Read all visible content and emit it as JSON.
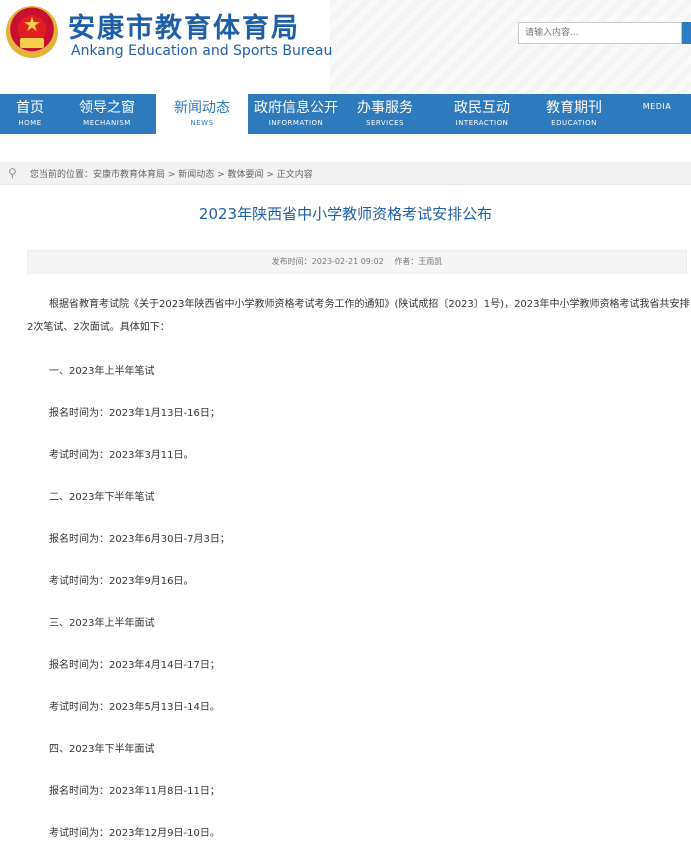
{
  "header": {
    "title": "安康市教育体育局",
    "subtitle": "Ankang Education and Sports Bureau",
    "search_placeholder": "请输入内容..."
  },
  "nav": {
    "items": [
      {
        "cn": "首页",
        "en": "HOME"
      },
      {
        "cn": "领导之窗",
        "en": "MECHANISM"
      },
      {
        "cn": "新闻动态",
        "en": "NEWS"
      },
      {
        "cn": "政府信息公开",
        "en": "INFORMATION"
      },
      {
        "cn": "办事服务",
        "en": "SERVICES"
      },
      {
        "cn": "政民互动",
        "en": "INTERACTION"
      },
      {
        "cn": "教育期刊",
        "en": "EDUCATION"
      },
      {
        "cn": "",
        "en": "MEDIA"
      }
    ]
  },
  "breadcrumb": {
    "text": "您当前的位置：安康市教育体育局 > 新闻动态 > 教体要闻 > 正文内容"
  },
  "article": {
    "title": "2023年陕西省中小学教师资格考试安排公布",
    "publish_time": "发布时间：2023-02-21 09:02",
    "author": "作者：王雨凯",
    "intro": "根据省教育考试院《关于2023年陕西省中小学教师资格考试考务工作的通知》(陕试成招〔2023〕1号)，2023年中小学教师资格考试我省共安排2次笔试、2次面试。具体如下：",
    "paragraphs": [
      "一、2023年上半年笔试",
      "报名时间为：2023年1月13日-16日；",
      "考试时间为：2023年3月11日。",
      "二、2023年下半年笔试",
      "报名时间为：2023年6月30日-7月3日；",
      "考试时间为：2023年9月16日。",
      "三、2023年上半年面试",
      "报名时间为：2023年4月14日-17日；",
      "考试时间为：2023年5月13日-14日。",
      "四、2023年下半年面试",
      "报名时间为：2023年11月8日-11日；",
      "考试时间为：2023年12月9日-10日。"
    ]
  },
  "colors": {
    "brand_blue": "#1f5fa8",
    "nav_blue": "#2f79bd"
  },
  "icons": {
    "emblem": "national-emblem",
    "breadcrumb": "location-pin-icon"
  }
}
